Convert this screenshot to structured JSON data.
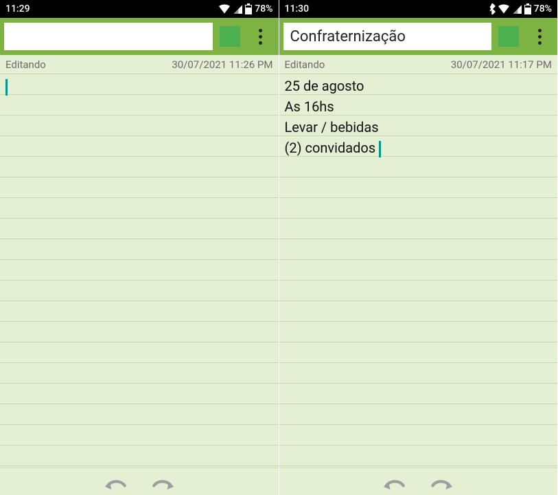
{
  "screens": [
    {
      "status_time": "11:29",
      "status_battery": "78%",
      "has_bt": false,
      "title_value": "",
      "meta_state": "Editando",
      "meta_date": "30/07/2021 11:26 PM",
      "note_text": ""
    },
    {
      "status_time": "11:30",
      "status_battery": "78%",
      "has_bt": true,
      "title_value": "Confraternização",
      "meta_state": "Editando",
      "meta_date": "30/07/2021 11:17 PM",
      "note_text": "25 de agosto\nAs 16hs\nLevar / bebidas\n(2) convidados"
    }
  ]
}
